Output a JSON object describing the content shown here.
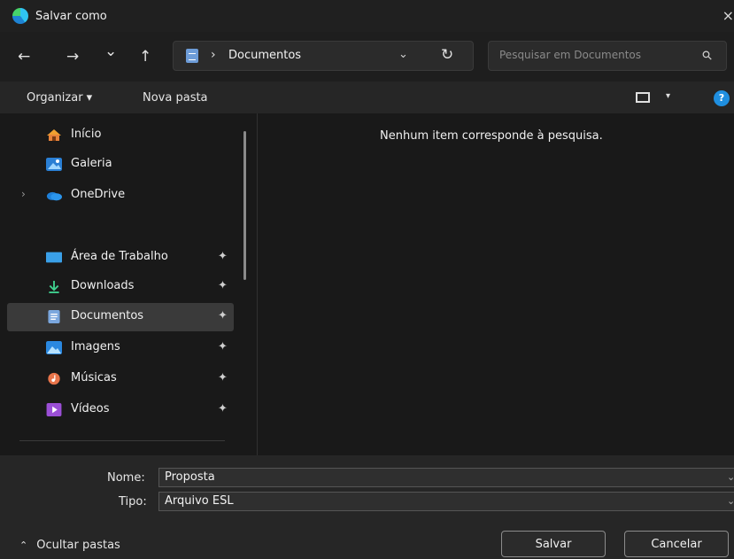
{
  "window": {
    "title": "Salvar como",
    "close": "×"
  },
  "nav": {
    "back": "←",
    "forward": "→",
    "recent": "⌄",
    "up": "↑",
    "address": {
      "separator": "›",
      "location": "Documentos",
      "dropdown": "⌄",
      "refresh": "↻"
    },
    "search": {
      "placeholder": "Pesquisar em Documentos",
      "icon": "search-icon"
    }
  },
  "toolbar": {
    "organize": "Organizar ▾",
    "new_folder": "Nova pasta",
    "help": "?",
    "view_chevron": "▾"
  },
  "sidebar": {
    "expand": "›",
    "pin": "✦",
    "items": [
      {
        "label": "Início",
        "icon": "home-icon"
      },
      {
        "label": "Galeria",
        "icon": "gallery-icon"
      },
      {
        "label": "OneDrive",
        "icon": "cloud-icon"
      },
      {
        "label": "Área de Trabalho",
        "icon": "desktop-icon"
      },
      {
        "label": "Downloads",
        "icon": "download-icon"
      },
      {
        "label": "Documentos",
        "icon": "documents-icon"
      },
      {
        "label": "Imagens",
        "icon": "pictures-icon"
      },
      {
        "label": "Músicas",
        "icon": "music-icon"
      },
      {
        "label": "Vídeos",
        "icon": "videos-icon"
      }
    ]
  },
  "content": {
    "empty_message": "Nenhum item corresponde à pesquisa."
  },
  "form": {
    "name_label": "Nome:",
    "name_value": "Proposta",
    "type_label": "Tipo:",
    "type_value": "Arquivo ESL",
    "dropdown": "⌄"
  },
  "footer": {
    "hide_folders": "Ocultar pastas",
    "hide_chevron": "⌃",
    "save": "Salvar",
    "cancel": "Cancelar"
  },
  "colors": {
    "accent": "#1f8fe0",
    "background": "#191919",
    "toolbar": "#262626"
  }
}
